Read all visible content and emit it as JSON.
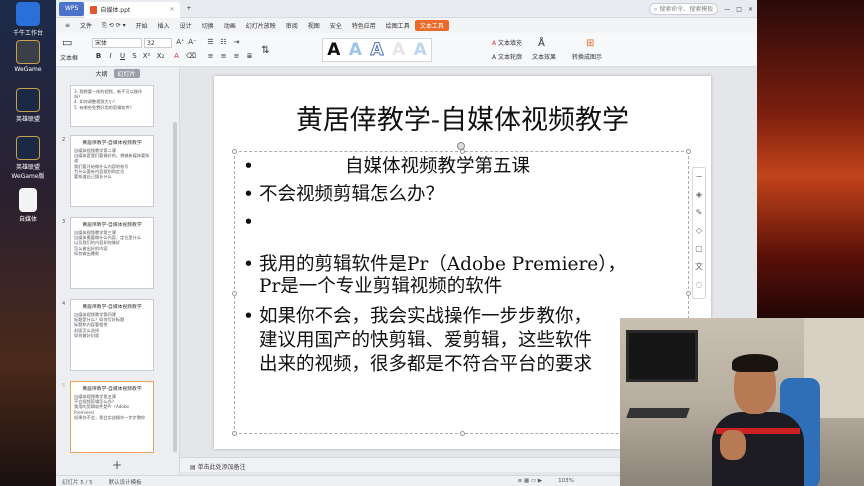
{
  "desktop": {
    "icons": [
      {
        "label": "千牛工作台"
      },
      {
        "label": "WeGame"
      },
      {
        "label": "英雄联盟"
      },
      {
        "label": "英雄联盟WeGame版"
      },
      {
        "label": "自媒体"
      }
    ]
  },
  "tabs": {
    "wps": "WPS",
    "doc": "自媒体.ppt",
    "new": "+"
  },
  "search": {
    "placeholder": "搜索命令、搜索模板"
  },
  "menu": [
    "文件",
    "开始",
    "插入",
    "设计",
    "切换",
    "动画",
    "幻灯片放映",
    "审阅",
    "视图",
    "安全",
    "特色应用",
    "绘图工具",
    "文本工具"
  ],
  "ribbon": {
    "font": "宋体",
    "size": "32",
    "text_fill": "文本填充",
    "text_outline": "文本轮廓",
    "text_effect": "文本效果",
    "text_box": "文本框",
    "convert": "转换成图示"
  },
  "panel": {
    "tabs": [
      "大纲",
      "幻灯片"
    ],
    "slides": [
      {
        "num": "",
        "title": "",
        "lines": [
          "3. 我想要一样的视频，新手可以操作吗？",
          "4. 如何调整视频大小？",
          "5. 有哪些免费好用的剪辑软件？"
        ]
      },
      {
        "num": "2",
        "title": "黄居倖教学-自媒体视频教学",
        "lines": [
          "自媒体视频教学第二课",
          "自媒体是我们要做好的，想做新媒体要知道",
          "我们要开始做什么内容的账号",
          "为什么要有内容规划和定位",
          "要知道自己擅长什么"
        ]
      },
      {
        "num": "3",
        "title": "黄居倖教学-自媒体视频教学",
        "lines": [
          "自媒体视频教学第三课",
          "自媒体需要做什么内容，定位是什么",
          "以及我们的内容如何做好",
          "怎么做出好的内容",
          "如何做出爆款"
        ]
      },
      {
        "num": "4",
        "title": "黄居倖教学-自媒体视频教学",
        "lines": [
          "自媒体视频教学第四课",
          "标题是什么？如何写好标题",
          "标题和内容要相关",
          "封面怎么选择",
          "如何做好封面"
        ]
      },
      {
        "num": "5",
        "title": "黄居倖教学-自媒体视频教学",
        "lines": [
          "自媒体视频教学第五课",
          "不会视频剪辑怎么办？",
          "我用的剪辑软件是Pr（Adobe Premiere）",
          "如果你不会，我会实战操作一步步教你"
        ]
      }
    ]
  },
  "slide": {
    "title": "黄居倖教学-自媒体视频教学",
    "bullets": [
      "自媒体视频教学第五课",
      "不会视频剪辑怎么办？",
      "",
      "我用的剪辑软件是Pr（Adobe Premiere），",
      "Pr是一个专业剪辑视频的软件",
      "如果你不会，我会实战操作一步步教你，",
      "建议用国产的快剪辑、爱剪辑，这些软件",
      "出来的视频，很多都是不符合平台的要求"
    ]
  },
  "notes": {
    "placeholder": "单击此处添加备注"
  },
  "status": {
    "slide": "幻灯片 5 / 5",
    "theme": "默认设计模板",
    "zoom": "103%"
  }
}
